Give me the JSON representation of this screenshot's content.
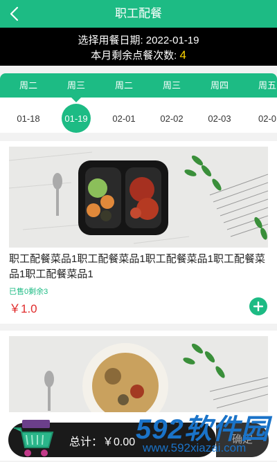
{
  "header": {
    "title": "职工配餐",
    "back_icon": "chevron-left-icon"
  },
  "info": {
    "date_label": "选择用餐日期: ",
    "date_value": "2022-01-19",
    "remain_label": "本月剩余点餐次数: ",
    "remain_value": "4"
  },
  "dates": {
    "weekdays": [
      "周二",
      "周三",
      "周二",
      "周三",
      "周四",
      "周五"
    ],
    "days": [
      "01-18",
      "01-19",
      "02-01",
      "02-02",
      "02-03",
      "02-0"
    ],
    "selected_index": 1
  },
  "items": [
    {
      "name": "职工配餐菜品1职工配餐菜品1职工配餐菜品1职工配餐菜品1职工配餐菜品1",
      "sold_remain": "已售0剩余3",
      "price": "￥1.0"
    }
  ],
  "footer": {
    "total_label": "总计：￥0.00",
    "confirm_label": "确定"
  },
  "watermark": {
    "brand": "592软件园",
    "site": "www.592xiazai.com"
  },
  "colors": {
    "accent": "#1dbb84",
    "price": "#e02a2a",
    "count": "#ffd600"
  }
}
